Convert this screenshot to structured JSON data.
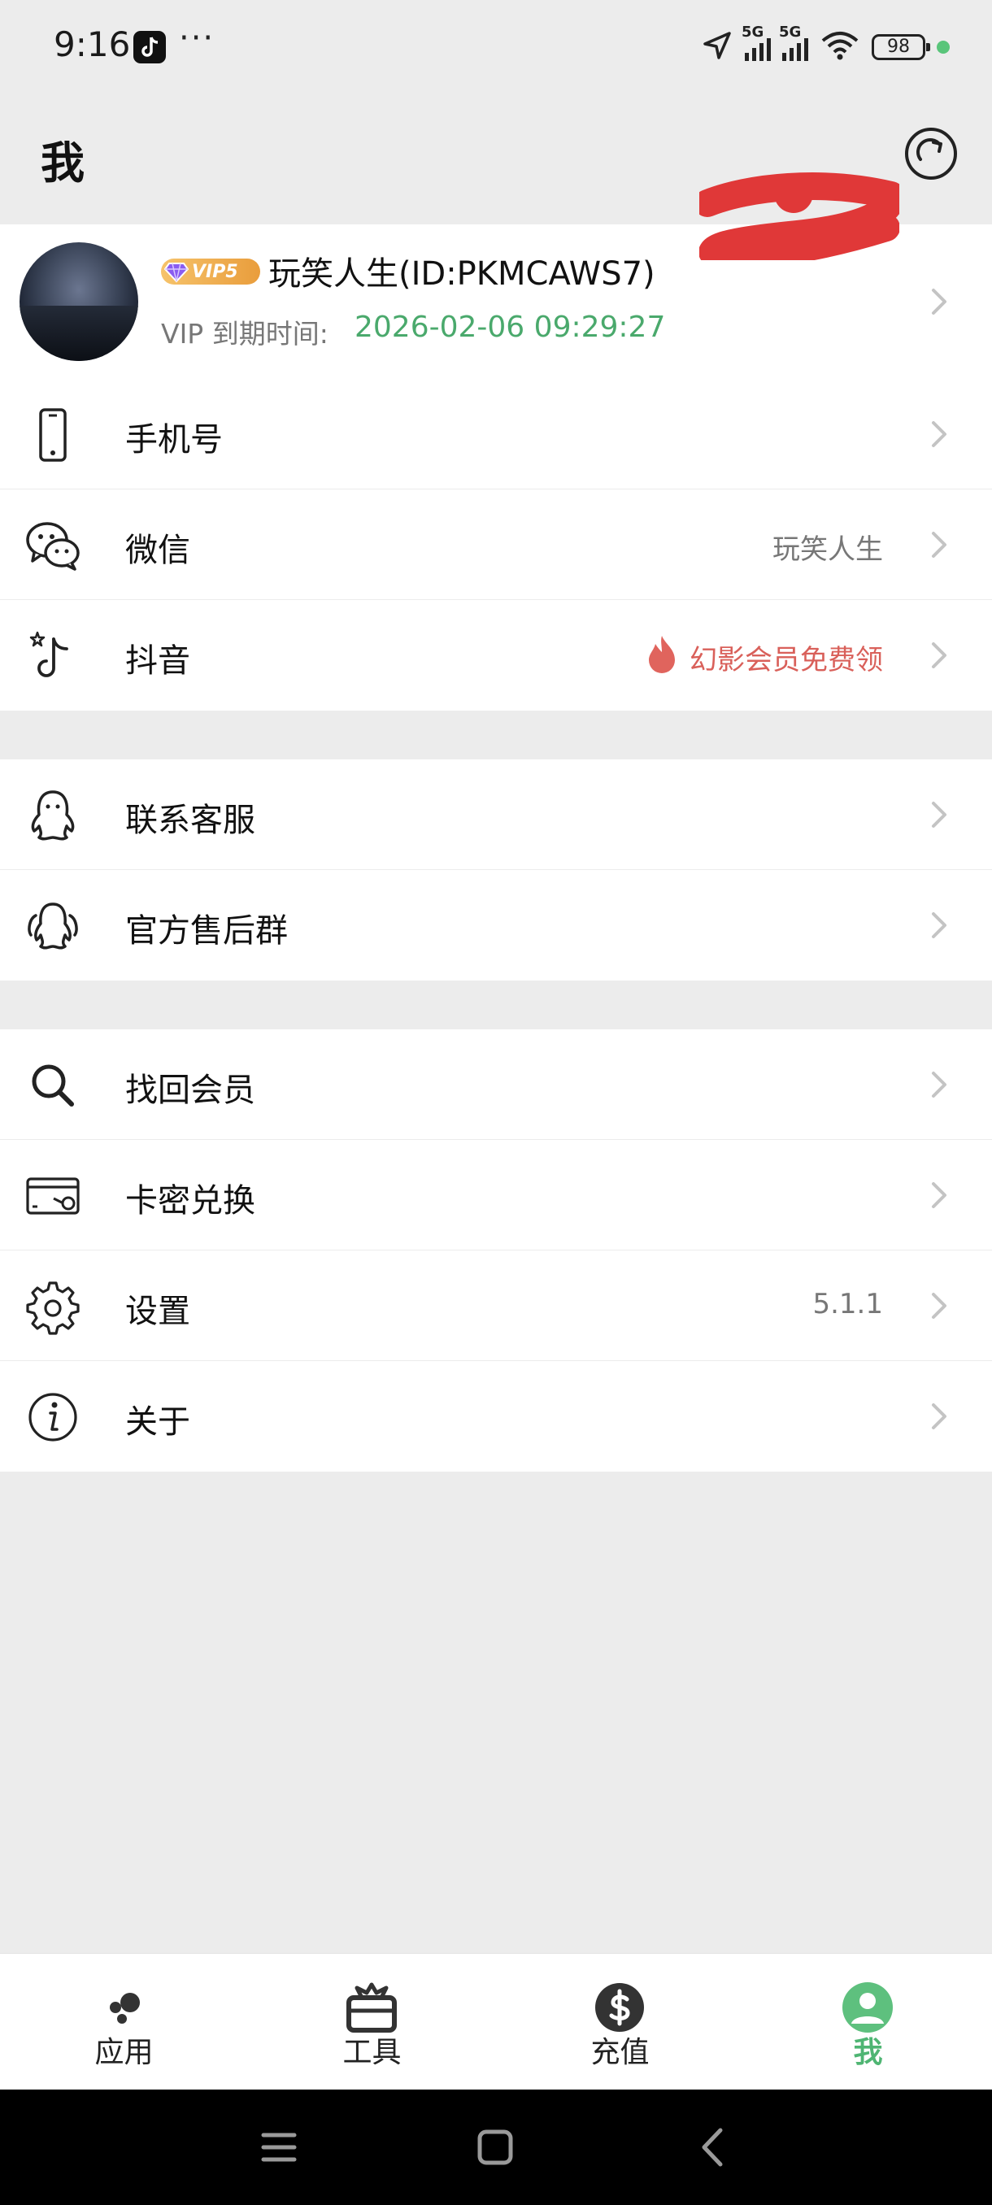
{
  "status_bar": {
    "time": "9:16",
    "more": "···",
    "net1": "5G",
    "net2": "5G",
    "battery": "98"
  },
  "header": {
    "title": "我"
  },
  "profile": {
    "vip_badge": "VIP5",
    "name": "玩笑人生(ID:PKMCAWS7)",
    "vip_expiry_label": "VIP 到期时间:",
    "vip_expiry_value": "2026-02-06 09:29:27"
  },
  "accounts": [
    {
      "label": "手机号",
      "value": "",
      "icon": "phone-icon"
    },
    {
      "label": "微信",
      "value": "玩笑人生",
      "icon": "wechat-icon"
    },
    {
      "label": "抖音",
      "value": "幻影会员免费领",
      "icon": "douyin-icon"
    }
  ],
  "support": [
    {
      "label": "联系客服",
      "icon": "qq-icon"
    },
    {
      "label": "官方售后群",
      "icon": "qq-group-icon"
    }
  ],
  "tools": [
    {
      "label": "找回会员",
      "value": "",
      "icon": "search-icon"
    },
    {
      "label": "卡密兑换",
      "value": "",
      "icon": "card-icon"
    },
    {
      "label": "设置",
      "value": "5.1.1",
      "icon": "gear-icon"
    },
    {
      "label": "关于",
      "value": "",
      "icon": "info-icon"
    }
  ],
  "bottom_nav": [
    {
      "label": "应用",
      "icon": "apps-icon",
      "active": false
    },
    {
      "label": "工具",
      "icon": "toolbox-icon",
      "active": false
    },
    {
      "label": "充值",
      "icon": "dollar-icon",
      "active": false
    },
    {
      "label": "我",
      "icon": "person-icon",
      "active": true
    }
  ],
  "colors": {
    "accent": "#4fb573",
    "expiry": "#4aa96c",
    "promo": "#d9605a",
    "background": "#ececec"
  }
}
